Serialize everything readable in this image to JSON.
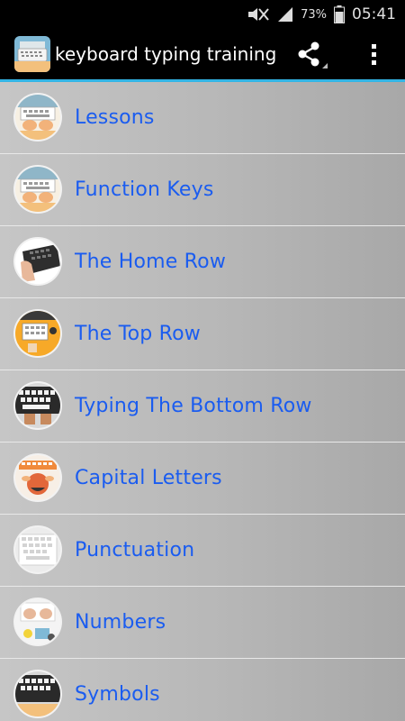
{
  "status_bar": {
    "battery_percent": "73%",
    "time": "05:41"
  },
  "app_bar": {
    "title": "keyboard typing training",
    "share_icon": "share-icon",
    "overflow_icon": "overflow-menu-icon"
  },
  "colors": {
    "accent_line": "#33b5e5",
    "item_text": "#1a5cf0",
    "list_background": "#bdbdbd"
  },
  "menu": {
    "items": [
      {
        "label": "Lessons",
        "icon": "keyboard-hands-icon"
      },
      {
        "label": "Function Keys",
        "icon": "keyboard-hands-icon"
      },
      {
        "label": "The Home Row",
        "icon": "laptop-hand-icon"
      },
      {
        "label": "The Top Row",
        "icon": "desk-keyboard-icon"
      },
      {
        "label": "Typing The Bottom Row",
        "icon": "black-keyboard-icon"
      },
      {
        "label": "Capital Letters",
        "icon": "typist-icon"
      },
      {
        "label": "Punctuation",
        "icon": "white-keyboard-icon"
      },
      {
        "label": "Numbers",
        "icon": "hands-keyboard-icon"
      },
      {
        "label": "Symbols",
        "icon": "keyboard-icon"
      }
    ]
  }
}
